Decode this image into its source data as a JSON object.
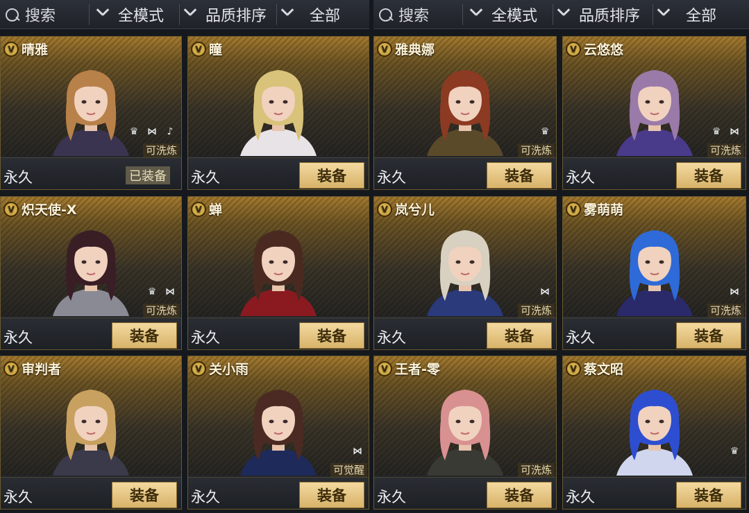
{
  "filters": [
    {
      "search_label": "搜索",
      "mode_label": "全模式",
      "sort_label": "品质排序",
      "type_label": "全部"
    },
    {
      "search_label": "搜索",
      "mode_label": "全模式",
      "sort_label": "品质排序",
      "type_label": "全部"
    }
  ],
  "cards": [
    {
      "name": "晴雅",
      "duration": "永久",
      "status": "已装备",
      "tag": "可洗炼",
      "hair": "#b88149",
      "outfit": "#3a3450",
      "icons": [
        "vip-icon",
        "bow-icon",
        "mic-icon"
      ]
    },
    {
      "name": "瞳",
      "duration": "永久",
      "status": "装备",
      "tag": "",
      "hair": "#d9c27a",
      "outfit": "#e8e3e6",
      "icons": []
    },
    {
      "name": "雅典娜",
      "duration": "永久",
      "status": "装备",
      "tag": "可洗炼",
      "hair": "#8d3a22",
      "outfit": "#5b4a2a",
      "icons": [
        "vip-icon"
      ]
    },
    {
      "name": "云悠悠",
      "duration": "永久",
      "status": "装备",
      "tag": "可洗炼",
      "hair": "#9a7aa8",
      "outfit": "#4a3a8a",
      "icons": [
        "vip-icon",
        "bow-icon"
      ]
    },
    {
      "name": "炽天使-X",
      "duration": "永久",
      "status": "装备",
      "tag": "可洗炼",
      "hair": "#3a1e26",
      "outfit": "#8a8a94",
      "icons": [
        "vip-icon",
        "bow-icon"
      ]
    },
    {
      "name": "蝉",
      "duration": "永久",
      "status": "装备",
      "tag": "",
      "hair": "#4a2a20",
      "outfit": "#8a1a20",
      "icons": []
    },
    {
      "name": "岚兮儿",
      "duration": "永久",
      "status": "装备",
      "tag": "可洗炼",
      "hair": "#d8d0c0",
      "outfit": "#2a3a7a",
      "icons": [
        "bow-icon"
      ]
    },
    {
      "name": "雾萌萌",
      "duration": "永久",
      "status": "装备",
      "tag": "可洗炼",
      "hair": "#2e6ad8",
      "outfit": "#2a2a6a",
      "icons": [
        "bow-icon"
      ]
    },
    {
      "name": "审判者",
      "duration": "永久",
      "status": "装备",
      "tag": "",
      "hair": "#c8a060",
      "outfit": "#3a3a4a",
      "icons": []
    },
    {
      "name": "关小雨",
      "duration": "永久",
      "status": "装备",
      "tag": "可觉醒",
      "hair": "#4a2a22",
      "outfit": "#1e2a5a",
      "icons": [
        "bow-icon"
      ]
    },
    {
      "name": "王者-零",
      "duration": "永久",
      "status": "装备",
      "tag": "可洗炼",
      "hair": "#d89090",
      "outfit": "#3a3a34",
      "icons": []
    },
    {
      "name": "蔡文昭",
      "duration": "永久",
      "status": "装备",
      "tag": "",
      "hair": "#2d4ed0",
      "outfit": "#cfd6ee",
      "icons": [
        "vip-icon"
      ]
    }
  ]
}
